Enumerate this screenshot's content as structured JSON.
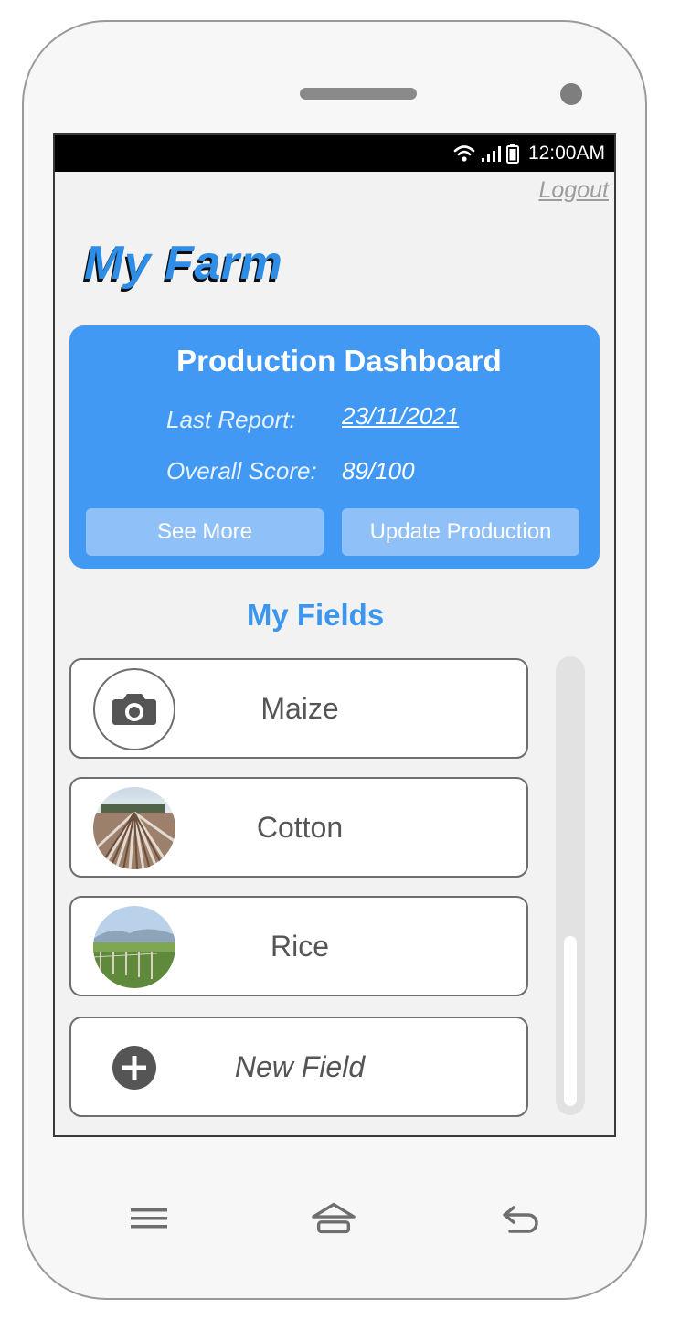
{
  "status_bar": {
    "time": "12:00AM",
    "wifi_icon": "wifi-icon",
    "signal_icon": "signal-icon",
    "battery_icon": "battery-icon"
  },
  "header": {
    "logout_label": "Logout",
    "app_title": "My Farm"
  },
  "dashboard": {
    "title": "Production Dashboard",
    "last_report_label": "Last Report:",
    "last_report_value": "23/11/2021",
    "overall_score_label": "Overall Score:",
    "overall_score_value": "89/100",
    "see_more_label": "See More",
    "update_label": "Update Production",
    "background_color": "#4299f4"
  },
  "fields": {
    "title": "My Fields",
    "items": [
      {
        "label": "Maize",
        "thumb": "camera-icon"
      },
      {
        "label": "Cotton",
        "thumb": "cotton-field-photo"
      },
      {
        "label": "Rice",
        "thumb": "rice-field-photo"
      }
    ],
    "new_field_label": "New Field",
    "new_field_icon": "plus-circle-icon"
  },
  "nav": {
    "menu_icon": "menu-icon",
    "home_icon": "home-icon",
    "back_icon": "back-icon"
  }
}
